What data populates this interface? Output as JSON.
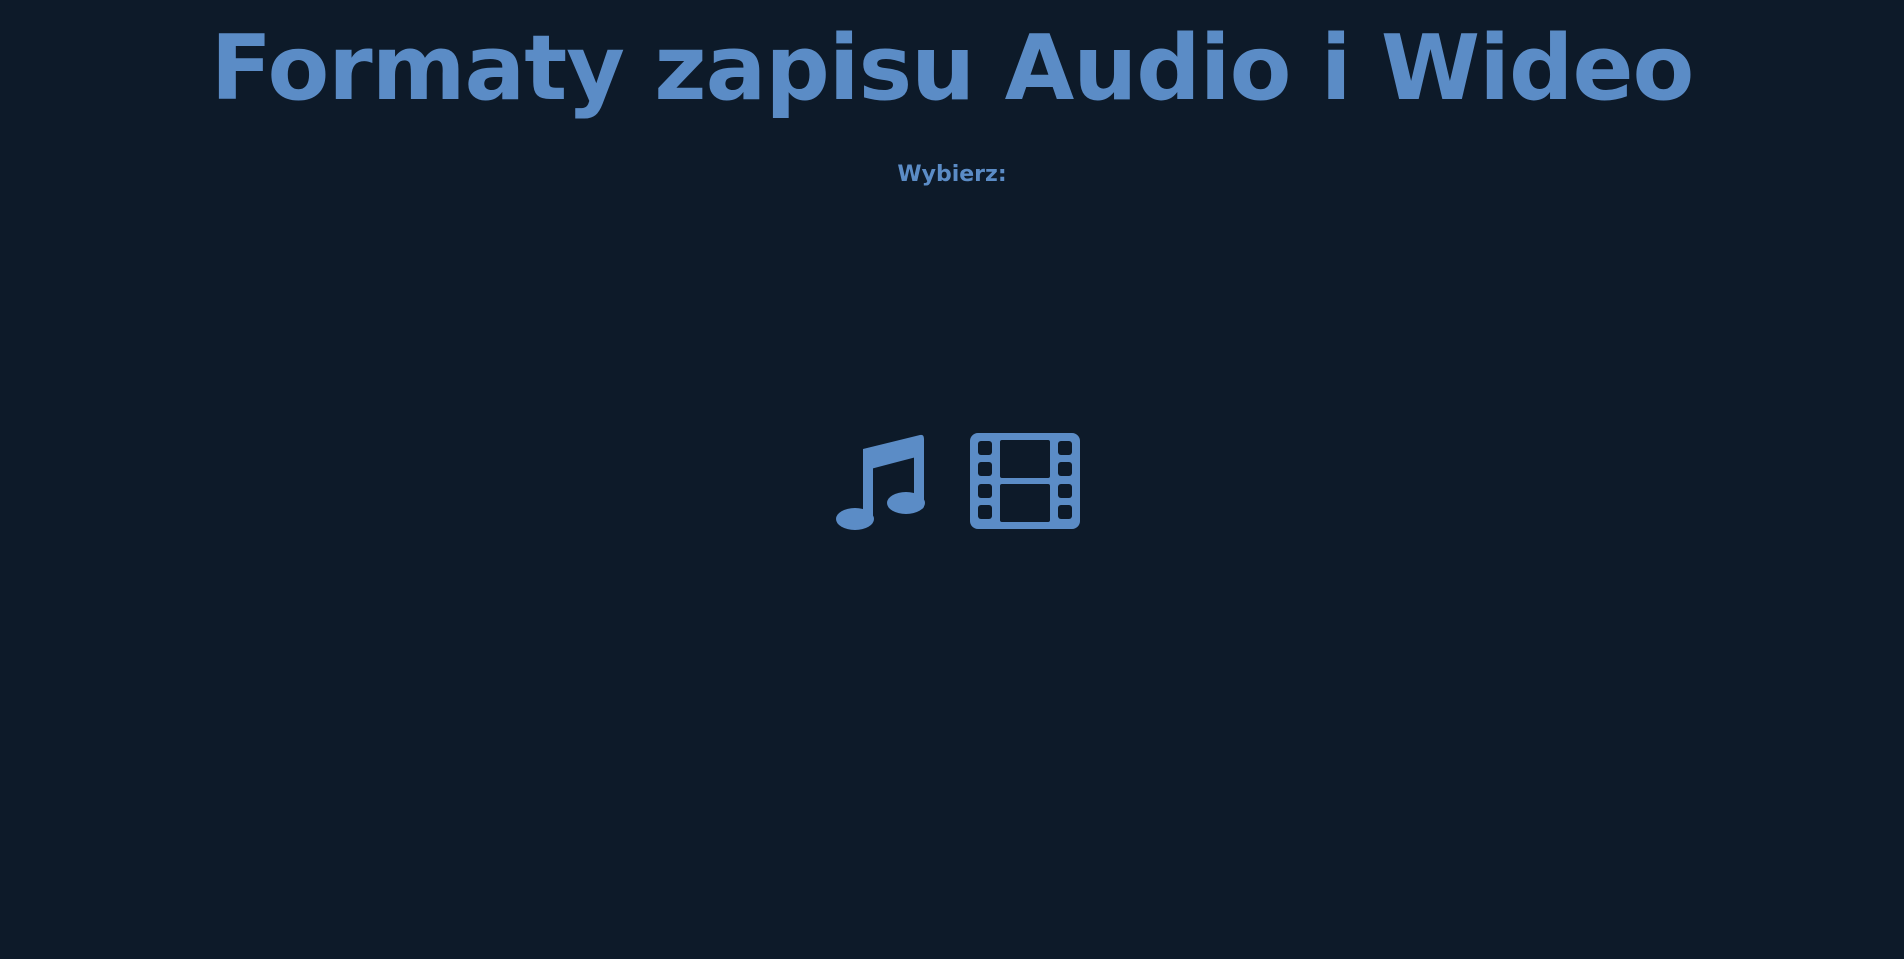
{
  "header": {
    "title": "Formaty zapisu Audio i Wideo"
  },
  "main": {
    "prompt": "Wybierz:",
    "choices": [
      {
        "id": "audio",
        "icon": "music-note-icon"
      },
      {
        "id": "video",
        "icon": "film-icon"
      }
    ]
  },
  "colors": {
    "background": "#0d1a29",
    "accent": "#5b8cc6"
  }
}
